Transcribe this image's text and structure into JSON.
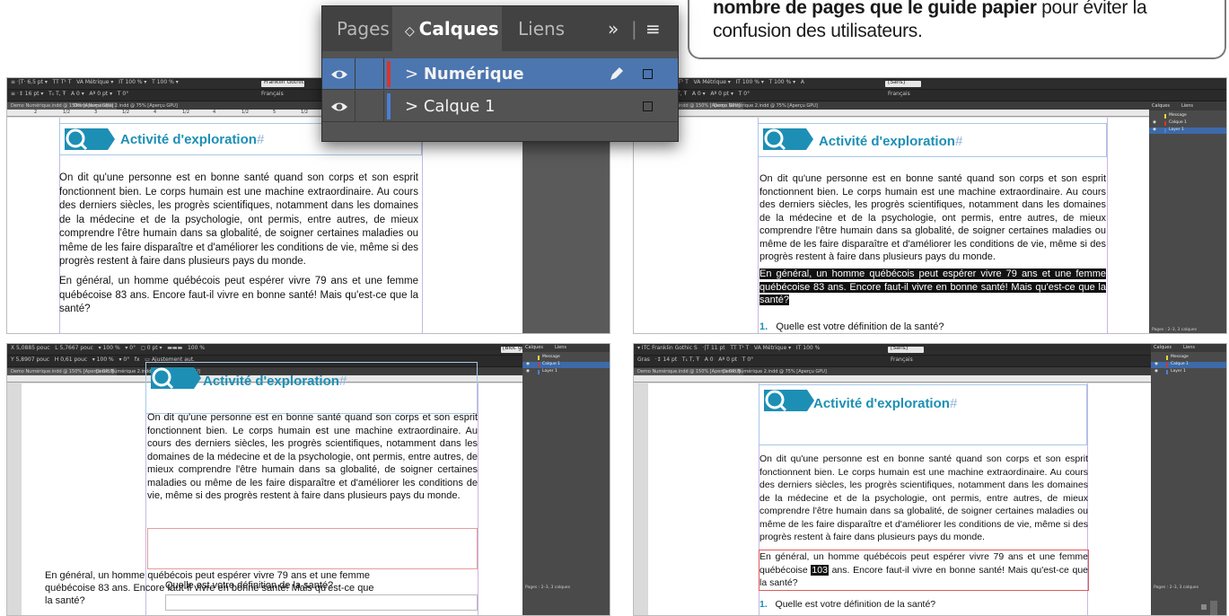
{
  "callout": {
    "line1_bold": "nombre de pages que le guide papier",
    "line1_rest": " pour éviter la",
    "line2": "confusion des utilisateurs."
  },
  "layers_panel": {
    "tabs": [
      "Pages",
      "Calques",
      "Liens"
    ],
    "more": "»",
    "menu": "≡",
    "layers": [
      {
        "name": "Numérique",
        "color": "#d9342b",
        "selected": true
      },
      {
        "name": "Calque 1",
        "color": "#4a7fd8",
        "selected": false
      }
    ]
  },
  "doc": {
    "title": "Activité d'exploration",
    "title_mark": "#",
    "pilcrow": "¶",
    "para1": "On dit qu'une personne est en bonne santé quand son corps et son esprit fonctionnent bien. Le corps humain est une machine extraordinaire. Au cours des derniers siècles, les progrès scientifiques, notamment dans les domaines de la médecine et de la psychologie, ont permis, entre autres, de mieux comprendre l'être humain dans sa globalité, de soigner certaines maladies ou même de les faire disparaître et d'améliorer les conditions de vie, même si des progrès restent à faire dans plusieurs pays du monde.",
    "para2": "En général, un homme québécois peut espérer vivre 79 ans et une femme québécoise 83 ans. Encore faut-il vivre en bonne santé! Mais qu'est-ce que la santé?",
    "para2_a": "En général, un homme québécois peut espérer vivre 79 ans et une femme québécoise ",
    "para2_num": "103",
    "para2_b": " ans. Encore faut-il vivre en bonne santé! Mais qu'est-ce que la santé?",
    "q1_num": "1.",
    "q1": "Quelle est votre définition de la santé?",
    "q1_short": "Quelle est votre définition de la santé?"
  },
  "shots": {
    "tab_a": "Demo Numérique.indd @ 150% [Aperçu GPU]",
    "tab_b": "Demo Numérique 2.indd @ 75% [Aperçu GPU]",
    "tab_c": "Demo Numérique.indd @ 150% [Aperçu GPU]",
    "mini_tabs": [
      "Calques",
      "Liens"
    ],
    "mini_layers": [
      "Message",
      "Calque 1",
      "Layer 1"
    ],
    "mini_footer": "Pages : 2–3, 3 calques",
    "ruler_nums": [
      "1/2",
      "1",
      "1/2",
      "2",
      "1/2",
      "3",
      "1/2",
      "4",
      "1/2",
      "5",
      "1/2",
      "6",
      "1/2",
      "7",
      "1/2"
    ],
    "ctrl_font": "Franklin Gothic",
    "ctrl_lang": "Français",
    "ctrl_style": "[Sans]",
    "ctrl_frame_style": "[Bloc graphique standard]+"
  },
  "colors": {
    "accent_blue": "#1d8fb5",
    "layer_red": "#d9342b",
    "layer_blue": "#4a7fd8",
    "panel_bg": "#535353",
    "selection": "#4b76b0"
  }
}
